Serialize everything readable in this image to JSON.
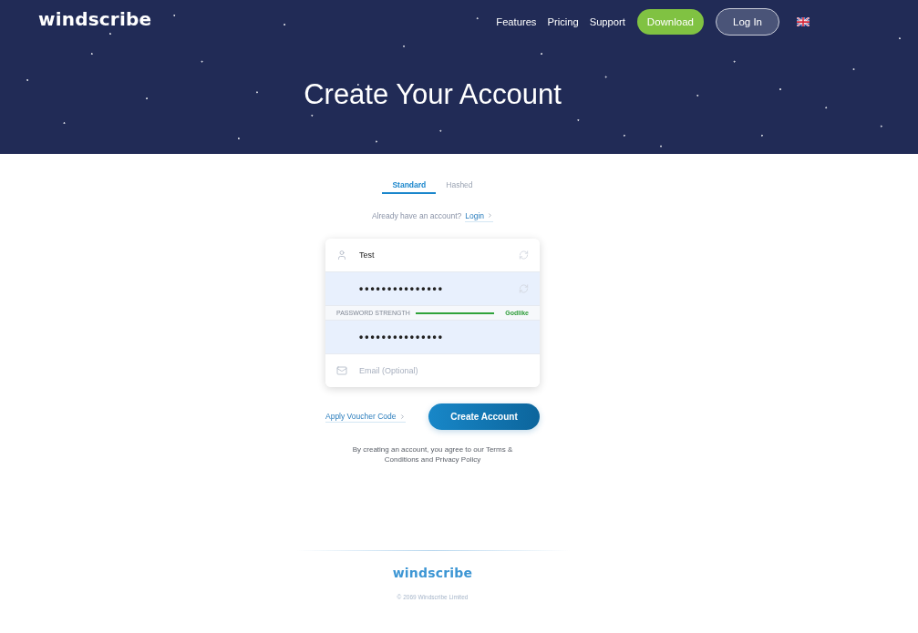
{
  "header": {
    "logo": "windscribe",
    "nav": [
      {
        "kind": "link",
        "label": "Features"
      },
      {
        "kind": "link",
        "label": "Pricing"
      },
      {
        "kind": "link",
        "label": "Support"
      },
      {
        "kind": "download",
        "label": "Download"
      },
      {
        "kind": "login",
        "label": "Log In"
      }
    ],
    "title": "Create Your Account"
  },
  "tabs": [
    {
      "label": "Standard",
      "selected": true
    },
    {
      "label": "Hashed",
      "selected": false
    }
  ],
  "login_prompt": {
    "text": "Already have an account?",
    "link": "Login"
  },
  "form": {
    "fields": [
      {
        "kind": "username",
        "value": "Test",
        "autofilled": false
      },
      {
        "kind": "password",
        "value": "•••••••••••••••",
        "autofilled": true
      },
      {
        "kind": "confirm_password",
        "value": "•••••••••••••••",
        "autofilled": true
      },
      {
        "kind": "email",
        "placeholder": "Email (Optional)",
        "autofilled": false
      }
    ],
    "strength": {
      "label": "PASSWORD STRENGTH",
      "level": 1,
      "rating": "Godlike"
    }
  },
  "voucher_link": "Apply Voucher Code",
  "submit_button": "Create Account",
  "terms": "By creating an account, you agree to our Terms & Conditions and Privacy Policy",
  "footer": {
    "logo": "windscribe",
    "copyright": "© 2069 Windscribe Limited"
  }
}
